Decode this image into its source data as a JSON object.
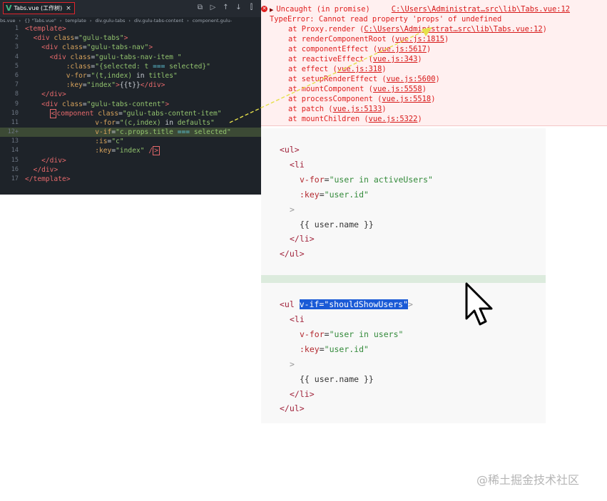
{
  "editor": {
    "tab": {
      "icon": "vue-icon",
      "label": "Tabs.vue (工作树)",
      "close": "×"
    },
    "toolbar": [
      "split-icon",
      "play-icon",
      "arrow-up-icon",
      "arrow-down-icon",
      "bookmark-icon"
    ],
    "toolbar_glyphs": [
      "⧉",
      "▷",
      "↑",
      "↓",
      "⫿"
    ],
    "breadcrumb": [
      "bs.vue",
      "›",
      "{} \"Tabs.vue\"",
      "›",
      "template",
      "›",
      "div.gulu-tabs",
      "›",
      "div.gulu-tabs-content",
      "›",
      "component.gulu-"
    ],
    "lines": [
      {
        "n": "1",
        "segs": [
          [
            "tag",
            "<template>"
          ]
        ]
      },
      {
        "n": "2",
        "segs": [
          [
            "plain",
            "  "
          ],
          [
            "tag",
            "<div "
          ],
          [
            "attr",
            "class"
          ],
          [
            "plain",
            "="
          ],
          [
            "str",
            "\"gulu-tabs\""
          ],
          [
            "tag",
            ">"
          ]
        ]
      },
      {
        "n": "3",
        "segs": [
          [
            "plain",
            "    "
          ],
          [
            "tag",
            "<div "
          ],
          [
            "attr",
            "class"
          ],
          [
            "plain",
            "="
          ],
          [
            "str",
            "\"gulu-tabs-nav\""
          ],
          [
            "tag",
            ">"
          ]
        ]
      },
      {
        "n": "4",
        "segs": [
          [
            "plain",
            "      "
          ],
          [
            "tag",
            "<div "
          ],
          [
            "attr",
            "class"
          ],
          [
            "plain",
            "="
          ],
          [
            "str",
            "\"gulu-tabs-nav-item \""
          ]
        ]
      },
      {
        "n": "5",
        "segs": [
          [
            "plain",
            "          "
          ],
          [
            "attr",
            ":class"
          ],
          [
            "plain",
            "="
          ],
          [
            "str",
            "\"{selected: t "
          ],
          [
            "op",
            "==="
          ],
          [
            "str",
            " selected}\""
          ]
        ]
      },
      {
        "n": "6",
        "segs": [
          [
            "plain",
            "          "
          ],
          [
            "attr",
            "v-for"
          ],
          [
            "plain",
            "="
          ],
          [
            "str",
            "\"(t,index) "
          ],
          [
            "plain",
            "in"
          ],
          [
            "str",
            " titles\""
          ]
        ]
      },
      {
        "n": "7",
        "segs": [
          [
            "plain",
            "          "
          ],
          [
            "attr",
            ":key"
          ],
          [
            "plain",
            "="
          ],
          [
            "str",
            "\"index\""
          ],
          [
            "tag",
            ">"
          ],
          [
            "plain",
            "{{t}}"
          ],
          [
            "tag",
            "</div>"
          ]
        ]
      },
      {
        "n": "8",
        "segs": [
          [
            "plain",
            "    "
          ],
          [
            "tag",
            "</div>"
          ]
        ]
      },
      {
        "n": "9",
        "segs": [
          [
            "plain",
            "    "
          ],
          [
            "tag",
            "<div "
          ],
          [
            "attr",
            "class"
          ],
          [
            "plain",
            "="
          ],
          [
            "str",
            "\"gulu-tabs-content\""
          ],
          [
            "tag",
            ">"
          ]
        ]
      },
      {
        "n": "10",
        "segs": [
          [
            "plain",
            "      "
          ],
          [
            "caret",
            "<"
          ],
          [
            "tag",
            "component "
          ],
          [
            "attr",
            "class"
          ],
          [
            "plain",
            "="
          ],
          [
            "str",
            "\"gulu-tabs-content-item\""
          ]
        ]
      },
      {
        "n": "11",
        "segs": [
          [
            "plain",
            "                 "
          ],
          [
            "attr",
            "v-for"
          ],
          [
            "plain",
            "="
          ],
          [
            "str",
            "\"(c,index) "
          ],
          [
            "plain",
            "in"
          ],
          [
            "str",
            " defaults\""
          ]
        ]
      },
      {
        "n": "12+",
        "hl": true,
        "segs": [
          [
            "plain",
            "                 "
          ],
          [
            "attr",
            "v-if"
          ],
          [
            "plain",
            "="
          ],
          [
            "str",
            "\"c.props.title "
          ],
          [
            "op",
            "==="
          ],
          [
            "str",
            " selected\""
          ]
        ]
      },
      {
        "n": "13",
        "segs": [
          [
            "plain",
            "                 "
          ],
          [
            "attr",
            ":is"
          ],
          [
            "plain",
            "="
          ],
          [
            "str",
            "\"c\""
          ]
        ]
      },
      {
        "n": "14",
        "segs": [
          [
            "plain",
            "                 "
          ],
          [
            "attr",
            ":key"
          ],
          [
            "plain",
            "="
          ],
          [
            "str",
            "\"index\" "
          ],
          [
            "tag",
            "/"
          ],
          [
            "caret",
            ">"
          ]
        ]
      },
      {
        "n": "15",
        "segs": [
          [
            "plain",
            "    "
          ],
          [
            "tag",
            "</div>"
          ]
        ]
      },
      {
        "n": "16",
        "segs": [
          [
            "plain",
            "  "
          ],
          [
            "tag",
            "</div>"
          ]
        ]
      },
      {
        "n": "17",
        "segs": [
          [
            "tag",
            "</template>"
          ]
        ]
      }
    ]
  },
  "console": {
    "uncaught": "Uncaught (in promise)",
    "source_link": "C:\\Users\\Administrat…src\\lib\\Tabs.vue:12",
    "error": "TypeError: Cannot read property 'props' of undefined",
    "stack": [
      {
        "at": "at Proxy.render (",
        "link": "C:\\Users\\Administrat…src\\lib\\Tabs.vue:12",
        "end": ")"
      },
      {
        "at": "at renderComponentRoot (",
        "link": "vue.js:1815",
        "end": ")"
      },
      {
        "at": "at componentEffect (",
        "link": "vue.js:5617",
        "end": ")"
      },
      {
        "at": "at reactiveEffect (",
        "link": "vue.js:343",
        "end": ")"
      },
      {
        "at": "at effect (",
        "link": "vue.js:318",
        "end": ")"
      },
      {
        "at": "at setupRenderEffect (",
        "link": "vue.js:5600",
        "end": ")"
      },
      {
        "at": "at mountComponent (",
        "link": "vue.js:5558",
        "end": ")"
      },
      {
        "at": "at processComponent (",
        "link": "vue.js:5518",
        "end": ")"
      },
      {
        "at": "at patch (",
        "link": "vue.js:5133",
        "end": ")"
      },
      {
        "at": "at mountChildren (",
        "link": "vue.js:5322",
        "end": ")"
      }
    ]
  },
  "example": {
    "block1": [
      {
        "ind": 0,
        "segs": [
          [
            "ptag",
            "<ul>"
          ]
        ]
      },
      {
        "ind": 1,
        "segs": [
          [
            "ptag",
            "<li"
          ]
        ]
      },
      {
        "ind": 2,
        "segs": [
          [
            "pattr",
            "v-for"
          ],
          [
            "pplain",
            "="
          ],
          [
            "pstr",
            "\"user in activeUsers\""
          ]
        ]
      },
      {
        "ind": 2,
        "segs": [
          [
            "pattr",
            ":key"
          ],
          [
            "pplain",
            "="
          ],
          [
            "pstr",
            "\"user.id\""
          ]
        ]
      },
      {
        "ind": 1,
        "segs": [
          [
            "pgrey",
            ">"
          ]
        ]
      },
      {
        "ind": 2,
        "segs": [
          [
            "pplain",
            "{{ user.name }}"
          ]
        ]
      },
      {
        "ind": 1,
        "segs": [
          [
            "ptag",
            "</li>"
          ]
        ]
      },
      {
        "ind": 0,
        "segs": [
          [
            "ptag",
            "</ul>"
          ]
        ]
      }
    ],
    "block2_head": {
      "tag": "<ul ",
      "selected": "v-if=\"shouldShowUsers\"",
      "close": ">"
    },
    "block2": [
      {
        "ind": 1,
        "segs": [
          [
            "ptag",
            "<li"
          ]
        ]
      },
      {
        "ind": 2,
        "segs": [
          [
            "pattr",
            "v-for"
          ],
          [
            "pplain",
            "="
          ],
          [
            "pstr",
            "\"user in users\""
          ]
        ]
      },
      {
        "ind": 2,
        "segs": [
          [
            "pattr",
            ":key"
          ],
          [
            "pplain",
            "="
          ],
          [
            "pstr",
            "\"user.id\""
          ]
        ]
      },
      {
        "ind": 1,
        "segs": [
          [
            "pgrey",
            ">"
          ]
        ]
      },
      {
        "ind": 2,
        "segs": [
          [
            "pplain",
            "{{ user.name }}"
          ]
        ]
      },
      {
        "ind": 1,
        "segs": [
          [
            "ptag",
            "</li>"
          ]
        ]
      },
      {
        "ind": 0,
        "segs": [
          [
            "ptag",
            "</ul>"
          ]
        ]
      }
    ]
  },
  "watermark": "@稀土掘金技术社区",
  "colors": {
    "editor_bg": "#1e2329",
    "console_bg": "#fff0f0",
    "error_red": "#e01f1f",
    "selection": "#1a5ad6",
    "arrow": "#e6e04a"
  }
}
